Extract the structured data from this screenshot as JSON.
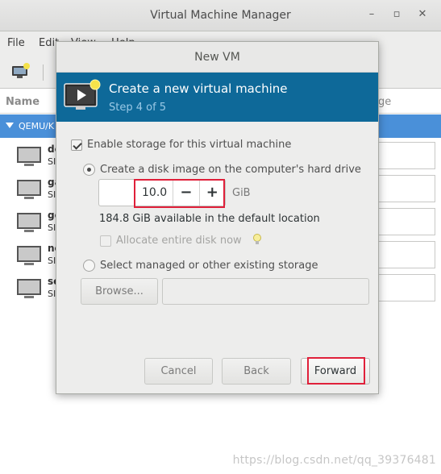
{
  "main_window": {
    "title": "Virtual Machine Manager",
    "wm_buttons": {
      "minimize": "–",
      "maximize": "▫",
      "close": "✕"
    },
    "menu": [
      "File",
      "Edit",
      "View",
      "Help"
    ],
    "columns": {
      "name": "Name",
      "cpu": "ge"
    },
    "group_label": "QEMU/K",
    "vms": [
      {
        "name": "de",
        "status": "SI"
      },
      {
        "name": "ga",
        "status": "SI"
      },
      {
        "name": "ge",
        "status": "SI"
      },
      {
        "name": "ne",
        "status": "SI"
      },
      {
        "name": "se",
        "status": "SI"
      }
    ],
    "watermark": "https://blog.csdn.net/qq_39376481"
  },
  "dialog": {
    "title": "New VM",
    "header": "Create a new virtual machine",
    "step": "Step 4 of 5",
    "enable_storage_label": "Enable storage for this virtual machine",
    "enable_storage_checked": true,
    "create_disk_label": "Create a disk image on the computer's hard drive",
    "disk_size": "10.0",
    "decrement": "−",
    "increment": "+",
    "unit": "GiB",
    "available": "184.8 GiB available in the default location",
    "allocate_label": "Allocate entire disk now",
    "select_existing_label": "Select managed or other existing storage",
    "browse_label": "Browse...",
    "path_value": "",
    "buttons": {
      "cancel": "Cancel",
      "back": "Back",
      "forward": "Forward"
    }
  },
  "colors": {
    "banner": "#0e6999",
    "group_selected": "#4a90d9",
    "highlight": "#e0203a"
  }
}
